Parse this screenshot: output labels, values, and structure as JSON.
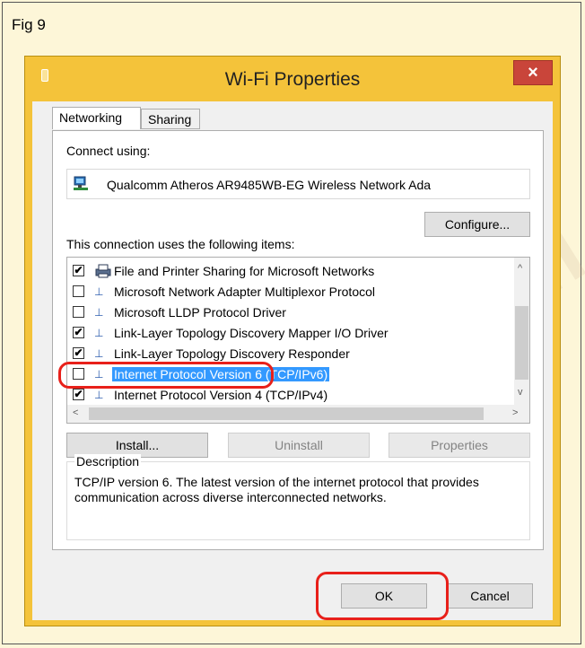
{
  "figure_label": "Fig 9",
  "watermark": "© NI IOT BE",
  "window": {
    "title": "Wi-Fi Properties",
    "close_icon": "×"
  },
  "tabs": [
    {
      "label": "Networking",
      "active": true
    },
    {
      "label": "Sharing",
      "active": false
    }
  ],
  "connect_using_label": "Connect using:",
  "adapter": {
    "icon": "network-adapter-icon",
    "name": "Qualcomm Atheros AR9485WB-EG Wireless Network Ada"
  },
  "configure_label": "Configure...",
  "items_label": "This connection uses the following items:",
  "items": [
    {
      "checked": true,
      "label": "File and Printer Sharing for Microsoft Networks",
      "icon": "printer-network-icon"
    },
    {
      "checked": false,
      "label": "Microsoft Network Adapter Multiplexor Protocol",
      "icon": "protocol-icon"
    },
    {
      "checked": false,
      "label": "Microsoft LLDP Protocol Driver",
      "icon": "protocol-icon"
    },
    {
      "checked": true,
      "label": "Link-Layer Topology Discovery Mapper I/O Driver",
      "icon": "protocol-icon"
    },
    {
      "checked": true,
      "label": "Link-Layer Topology Discovery Responder",
      "icon": "protocol-icon"
    },
    {
      "checked": false,
      "label": "Internet Protocol Version 6 (TCP/IPv6)",
      "icon": "protocol-icon",
      "selected": true
    },
    {
      "checked": true,
      "label": "Internet Protocol Version 4 (TCP/IPv4)",
      "icon": "protocol-icon"
    }
  ],
  "buttons": {
    "install": "Install...",
    "uninstall": "Uninstall",
    "properties": "Properties",
    "ok": "OK",
    "cancel": "Cancel"
  },
  "description": {
    "title": "Description",
    "text": "TCP/IP version 6. The latest version of the internet protocol that provides communication across diverse interconnected networks."
  },
  "colors": {
    "titlebar": "#f4c33a",
    "close_button": "#c9453a",
    "selection": "#3399ff",
    "callout": "#e8201a"
  }
}
